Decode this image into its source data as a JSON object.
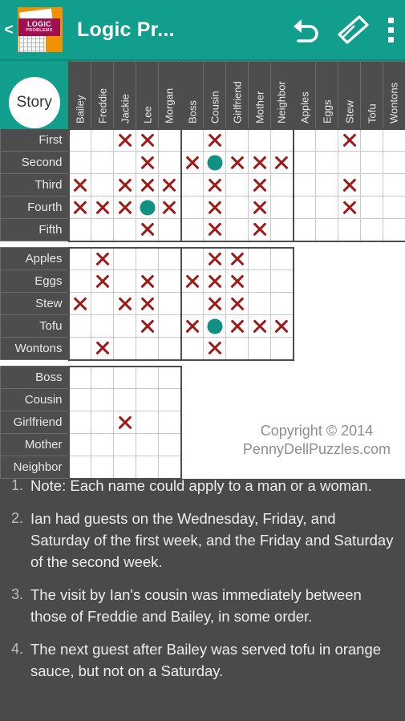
{
  "appbar": {
    "back_label": "<",
    "title": "Logic Pr...",
    "logo_text_main": "LOGIC",
    "logo_text_sub": "PROBLEMS",
    "undo_icon": "undo-icon",
    "eraser_icon": "eraser-icon",
    "menu_icon": "overflow-menu-icon",
    "accent_color": "#119e8c"
  },
  "grid": {
    "corner_label": "Story",
    "column_groups": [
      {
        "name": "names",
        "columns": [
          "Bailey",
          "Freddie",
          "Jackie",
          "Lee",
          "Morgan"
        ]
      },
      {
        "name": "relations",
        "columns": [
          "Boss",
          "Cousin",
          "Girlfriend",
          "Mother",
          "Neighbor"
        ]
      },
      {
        "name": "foods",
        "columns": [
          "Apples",
          "Eggs",
          "Stew",
          "Tofu",
          "Wontons"
        ]
      }
    ],
    "row_groups": [
      {
        "name": "order",
        "rows": [
          {
            "label": "First",
            "names": [
              "",
              "",
              "x",
              "x",
              ""
            ],
            "relations": [
              "",
              "x",
              "",
              "",
              ""
            ],
            "foods": [
              "",
              "",
              "x",
              "",
              ""
            ]
          },
          {
            "label": "Second",
            "names": [
              "",
              "",
              "",
              "x",
              ""
            ],
            "relations": [
              "x",
              "dot",
              "x",
              "x",
              "x"
            ],
            "foods": [
              "",
              "",
              "",
              "",
              ""
            ]
          },
          {
            "label": "Third",
            "names": [
              "x",
              "",
              "x",
              "x",
              "x"
            ],
            "relations": [
              "",
              "x",
              "",
              "x",
              ""
            ],
            "foods": [
              "",
              "",
              "x",
              "",
              ""
            ]
          },
          {
            "label": "Fourth",
            "names": [
              "x",
              "x",
              "x",
              "dot",
              "x"
            ],
            "relations": [
              "",
              "x",
              "",
              "x",
              ""
            ],
            "foods": [
              "",
              "",
              "x",
              "",
              ""
            ]
          },
          {
            "label": "Fifth",
            "names": [
              "",
              "",
              "",
              "x",
              ""
            ],
            "relations": [
              "",
              "x",
              "",
              "x",
              ""
            ],
            "foods": [
              "",
              "",
              "",
              "",
              ""
            ]
          }
        ]
      },
      {
        "name": "foods",
        "rows": [
          {
            "label": "Apples",
            "names": [
              "",
              "x",
              "",
              "",
              ""
            ],
            "relations": [
              "",
              "x",
              "x",
              "",
              ""
            ]
          },
          {
            "label": "Eggs",
            "names": [
              "",
              "x",
              "",
              "x",
              ""
            ],
            "relations": [
              "x",
              "x",
              "x",
              "",
              ""
            ]
          },
          {
            "label": "Stew",
            "names": [
              "x",
              "",
              "x",
              "x",
              ""
            ],
            "relations": [
              "",
              "x",
              "x",
              "",
              ""
            ]
          },
          {
            "label": "Tofu",
            "names": [
              "",
              "",
              "",
              "x",
              ""
            ],
            "relations": [
              "x",
              "dot",
              "x",
              "x",
              "x"
            ]
          },
          {
            "label": "Wontons",
            "names": [
              "",
              "x",
              "",
              "",
              ""
            ],
            "relations": [
              "",
              "x",
              "",
              "",
              ""
            ]
          }
        ]
      },
      {
        "name": "relations",
        "rows": [
          {
            "label": "Boss",
            "names": [
              "",
              "",
              "",
              "",
              ""
            ]
          },
          {
            "label": "Cousin",
            "names": [
              "",
              "",
              "",
              "",
              ""
            ]
          },
          {
            "label": "Girlfriend",
            "names": [
              "",
              "",
              "x",
              "",
              ""
            ]
          },
          {
            "label": "Mother",
            "names": [
              "",
              "",
              "",
              "",
              ""
            ]
          },
          {
            "label": "Neighbor",
            "names": [
              "",
              "",
              "",
              "",
              ""
            ]
          }
        ]
      }
    ],
    "copyright_line1": "Copyright © 2014",
    "copyright_line2": "PennyDellPuzzles.com",
    "x_color": "#9c1b18",
    "dot_color": "#109184"
  },
  "clues": [
    {
      "num": "1.",
      "text": "Note: Each name could apply to a man or a woman."
    },
    {
      "num": "2.",
      "text": "Ian had guests on the Wednesday, Friday, and Saturday of the first week, and the Friday and Saturday of the second week."
    },
    {
      "num": "3.",
      "text": "The visit by Ian's cousin was immediately between those of Freddie and Bailey, in some order."
    },
    {
      "num": "4.",
      "text": "The next guest after Bailey was served tofu in orange sauce, but not on a Saturday."
    }
  ]
}
